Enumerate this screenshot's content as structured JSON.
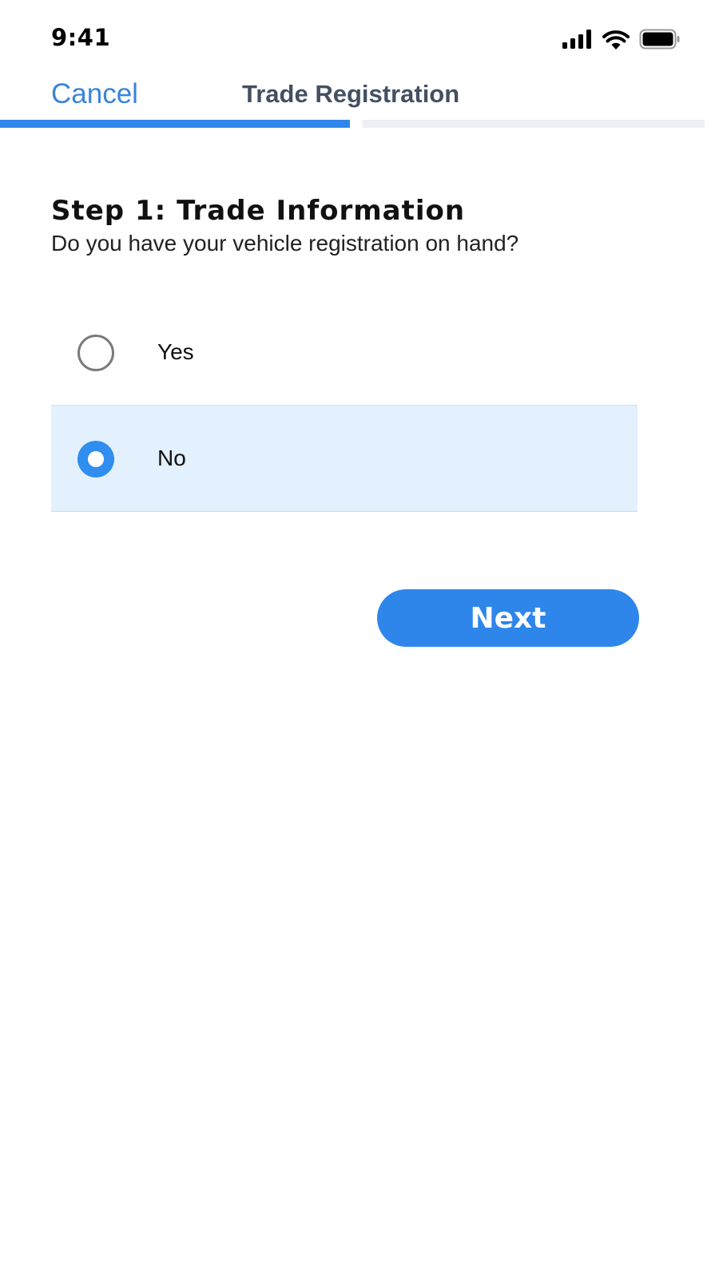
{
  "status_bar": {
    "time": "9:41",
    "icons": [
      "cellular-signal-icon",
      "wifi-icon",
      "battery-icon"
    ]
  },
  "nav": {
    "cancel_label": "Cancel",
    "title": "Trade Registration"
  },
  "progress": {
    "fraction": 0.5,
    "fill_color": "#2f86ea",
    "track_color": "#eceff3"
  },
  "step": {
    "title": "Step 1: Trade Information",
    "question": "Do you have your vehicle registration on hand?"
  },
  "options": [
    {
      "label": "Yes",
      "selected": false
    },
    {
      "label": "No",
      "selected": true
    }
  ],
  "actions": {
    "next_label": "Next"
  },
  "colors": {
    "accent": "#2f86ea",
    "link": "#3a85d8",
    "selected_row_bg": "#e3f0fd"
  }
}
